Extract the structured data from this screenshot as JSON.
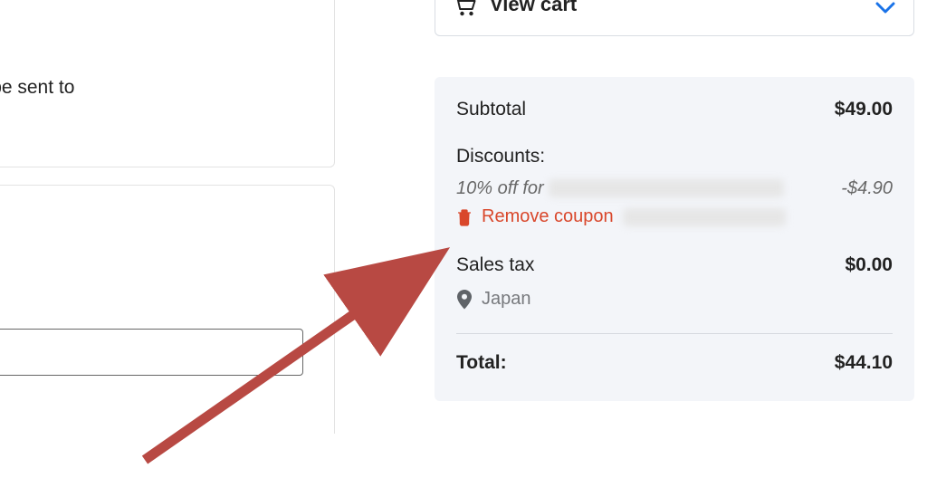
{
  "left": {
    "notice_fragment": "tions will be sent to"
  },
  "cart": {
    "view_label": "View cart"
  },
  "summary": {
    "subtotal_label": "Subtotal",
    "subtotal_value": "$49.00",
    "discounts_label": "Discounts:",
    "discount_descr": "10% off for ",
    "discount_value": "-$4.90",
    "remove_coupon_label": "Remove coupon ",
    "salestax_label": "Sales tax",
    "salestax_value": "$0.00",
    "location": "Japan",
    "total_label": "Total:",
    "total_value": "$44.10"
  },
  "colors": {
    "accent_remove": "#d9472b",
    "chevron_blue": "#1a73e8",
    "arrow_red": "#b84943"
  }
}
